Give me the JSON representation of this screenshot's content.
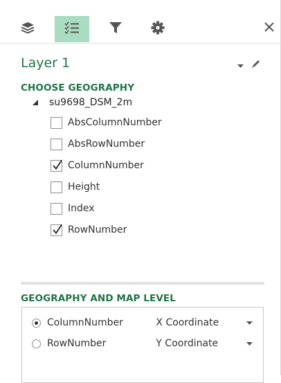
{
  "toolbar": {
    "buttons": [
      {
        "name": "layers-icon",
        "active": false
      },
      {
        "name": "field-list-icon",
        "active": true
      },
      {
        "name": "filter-icon",
        "active": false
      },
      {
        "name": "settings-icon",
        "active": false
      }
    ],
    "close_icon": "close-icon"
  },
  "layer": {
    "title": "Layer 1"
  },
  "choose_geography": {
    "heading": "CHOOSE GEOGRAPHY",
    "table": "su9698_DSM_2m",
    "fields": [
      {
        "label": "AbsColumnNumber",
        "checked": false
      },
      {
        "label": "AbsRowNumber",
        "checked": false
      },
      {
        "label": "ColumnNumber",
        "checked": true
      },
      {
        "label": "Height",
        "checked": false
      },
      {
        "label": "Index",
        "checked": false
      },
      {
        "label": "RowNumber",
        "checked": true
      }
    ]
  },
  "geography_map_level": {
    "heading": "GEOGRAPHY AND MAP LEVEL",
    "rows": [
      {
        "field": "ColumnNumber",
        "level": "X Coordinate",
        "selected": true
      },
      {
        "field": "RowNumber",
        "level": "Y Coordinate",
        "selected": false
      }
    ]
  },
  "colors": {
    "accent": "#217346",
    "active_tab": "#a9dcc0"
  }
}
